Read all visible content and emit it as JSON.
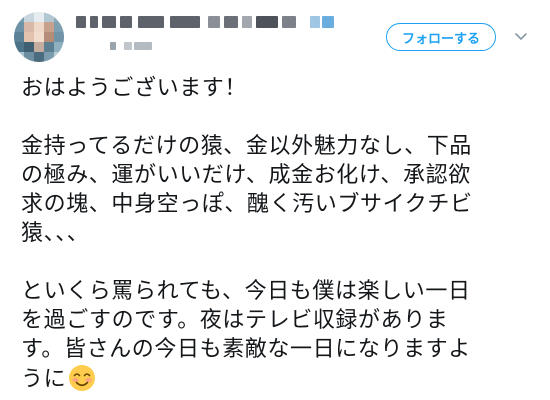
{
  "header": {
    "follow_button": "フォローする",
    "menu_icon": "chevron-down-icon"
  },
  "tweet": {
    "lines": [
      "おはようございます！",
      "",
      "金持ってるだけの猿、金以外魅力なし、下品",
      "の極み、運がいいだけ、成金お化け、承認欲",
      "求の塊、中身空っぽ、醜く汚いブサイクチビ",
      "猿、、、",
      "",
      "といくら罵られても、今日も僕は楽しい一日",
      "を過ごすのです。夜はテレビ収録がありま",
      "す。皆さんの今日も素敵な一日になりますよ",
      "うに"
    ],
    "emoji": "smiling-face-with-blush-emoji"
  },
  "colors": {
    "accent": "#1da1f2",
    "text": "#14171a",
    "muted": "#8899a6"
  }
}
